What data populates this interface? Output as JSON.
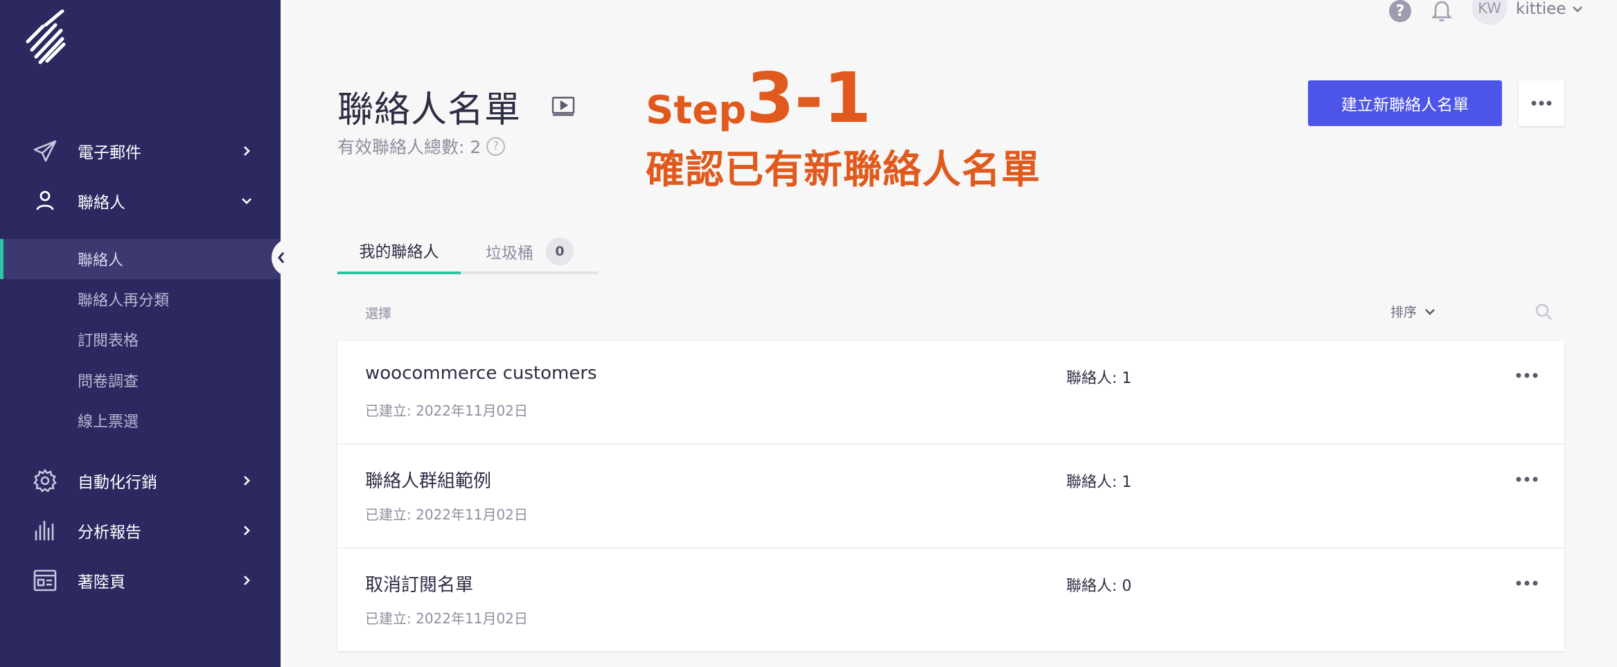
{
  "sidebar": {
    "nav": [
      {
        "label": "電子郵件",
        "icon": "paper-plane-icon"
      },
      {
        "label": "聯絡人",
        "icon": "user-icon"
      },
      {
        "label": "自動化行銷",
        "icon": "gear-icon"
      },
      {
        "label": "分析報告",
        "icon": "bar-chart-icon"
      },
      {
        "label": "著陸頁",
        "icon": "landing-page-icon"
      }
    ],
    "subnav": [
      {
        "label": "聯絡人"
      },
      {
        "label": "聯絡人再分類"
      },
      {
        "label": "訂閱表格"
      },
      {
        "label": "問卷調查"
      },
      {
        "label": "線上票選"
      }
    ]
  },
  "topbar": {
    "help": "?",
    "avatar_initials": "KW",
    "username": "kittiee"
  },
  "header": {
    "title": "聯絡人名單",
    "summary": "有效聯絡人總數: 2",
    "create_button": "建立新聯絡人名單"
  },
  "annotation": {
    "step_word": "Step",
    "step_number": "3-1",
    "subtitle": "確認已有新聯絡人名單"
  },
  "tabs": {
    "mine": "我的聯絡人",
    "trash": "垃圾桶",
    "trash_count": "0"
  },
  "toolbar": {
    "select": "選擇",
    "sort": "排序"
  },
  "lists": [
    {
      "name": "woocommerce customers",
      "created": "已建立: 2022年11月02日",
      "count": "聯絡人: 1"
    },
    {
      "name": "聯絡人群組範例",
      "created": "已建立: 2022年11月02日",
      "count": "聯絡人: 1"
    },
    {
      "name": "取消訂閱名單",
      "created": "已建立: 2022年11月02日",
      "count": "聯絡人: 0"
    }
  ],
  "colors": {
    "sidebar_bg": "#2b2960",
    "primary_button": "#4d55e8",
    "active_accent": "#2ec4a0",
    "annotation": "#e05a1e"
  }
}
